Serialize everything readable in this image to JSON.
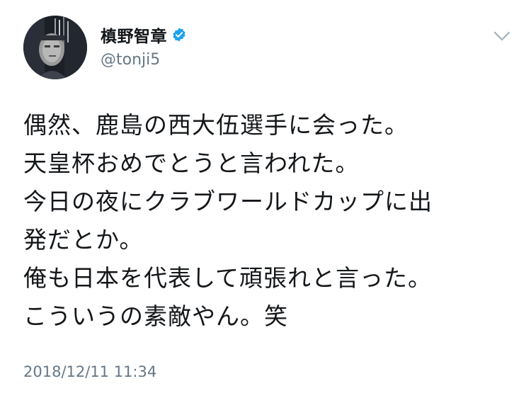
{
  "user": {
    "display_name": "槙野智章",
    "handle": "@tonji5",
    "avatar_icon": "profile-photo",
    "verified_icon": "verified-badge-icon",
    "verified_color": "#1da1f2"
  },
  "tweet": {
    "lines": [
      "偶然、鹿島の西大伍選手に会った。",
      "天皇杯おめでとうと言われた。",
      "今日の夜にクラブワールドカップに出",
      "発だとか。",
      "俺も日本を代表して頑張れと言った。",
      "こういうの素敵やん。笑"
    ],
    "timestamp": "2018/12/11 11:34"
  },
  "menu": {
    "icon": "chevron-down-icon"
  },
  "colors": {
    "text": "#14171a",
    "secondary": "#657786",
    "background": "#ffffff"
  }
}
